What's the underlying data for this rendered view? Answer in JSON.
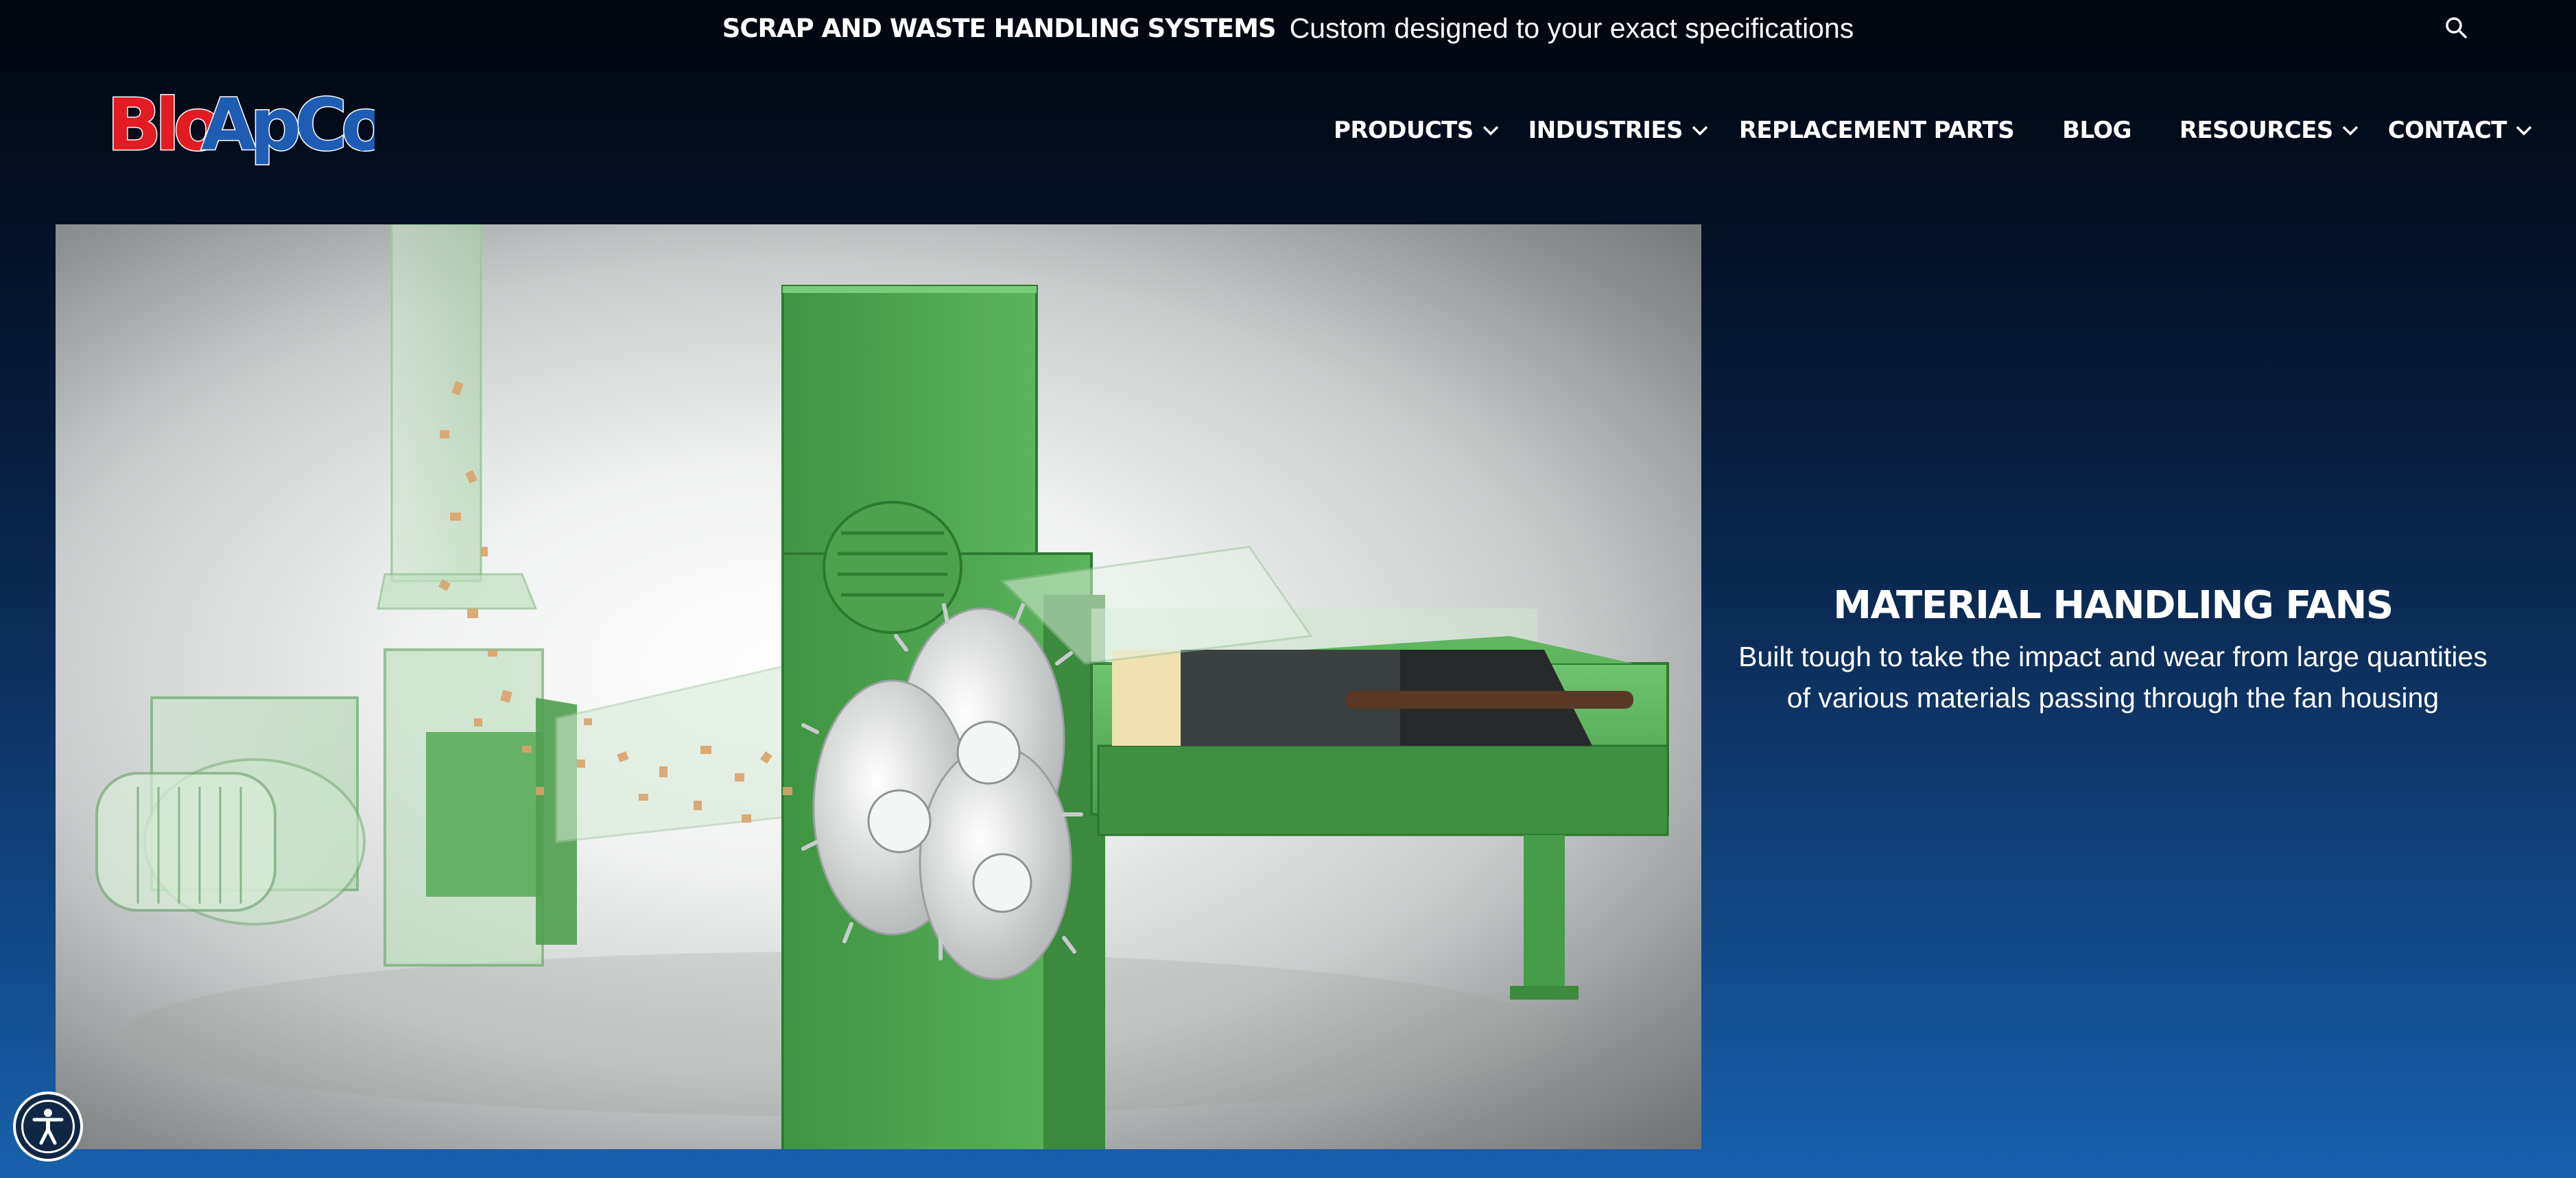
{
  "announcement": {
    "headline": "SCRAP AND WASTE HANDLING SYSTEMS",
    "tagline": "Custom designed to your exact specifications"
  },
  "header": {
    "logo": {
      "text": "BloApCo",
      "part_red": "Blo",
      "part_blue": "ApCo",
      "color_red": "#e31b23",
      "color_blue": "#1f5db5"
    },
    "search_icon": "search-icon"
  },
  "nav": {
    "items": [
      {
        "label": "PRODUCTS",
        "has_dropdown": true
      },
      {
        "label": "INDUSTRIES",
        "has_dropdown": true
      },
      {
        "label": "REPLACEMENT PARTS",
        "has_dropdown": false
      },
      {
        "label": "BLOG",
        "has_dropdown": false
      },
      {
        "label": "RESOURCES",
        "has_dropdown": true
      },
      {
        "label": "CONTACT",
        "has_dropdown": true
      }
    ]
  },
  "feature": {
    "title": "MATERIAL HANDLING FANS",
    "description": "Built tough to take the impact and wear from large quantities of various materials passing through the fan housing",
    "image_subject": "green industrial shredder with blower fan and conveyor"
  },
  "accessibility": {
    "icon": "accessibility-icon"
  },
  "colors": {
    "background_top": "#02060e",
    "background_bottom": "#1860ad",
    "machine_green": "#4fa64f",
    "text": "#ffffff"
  }
}
